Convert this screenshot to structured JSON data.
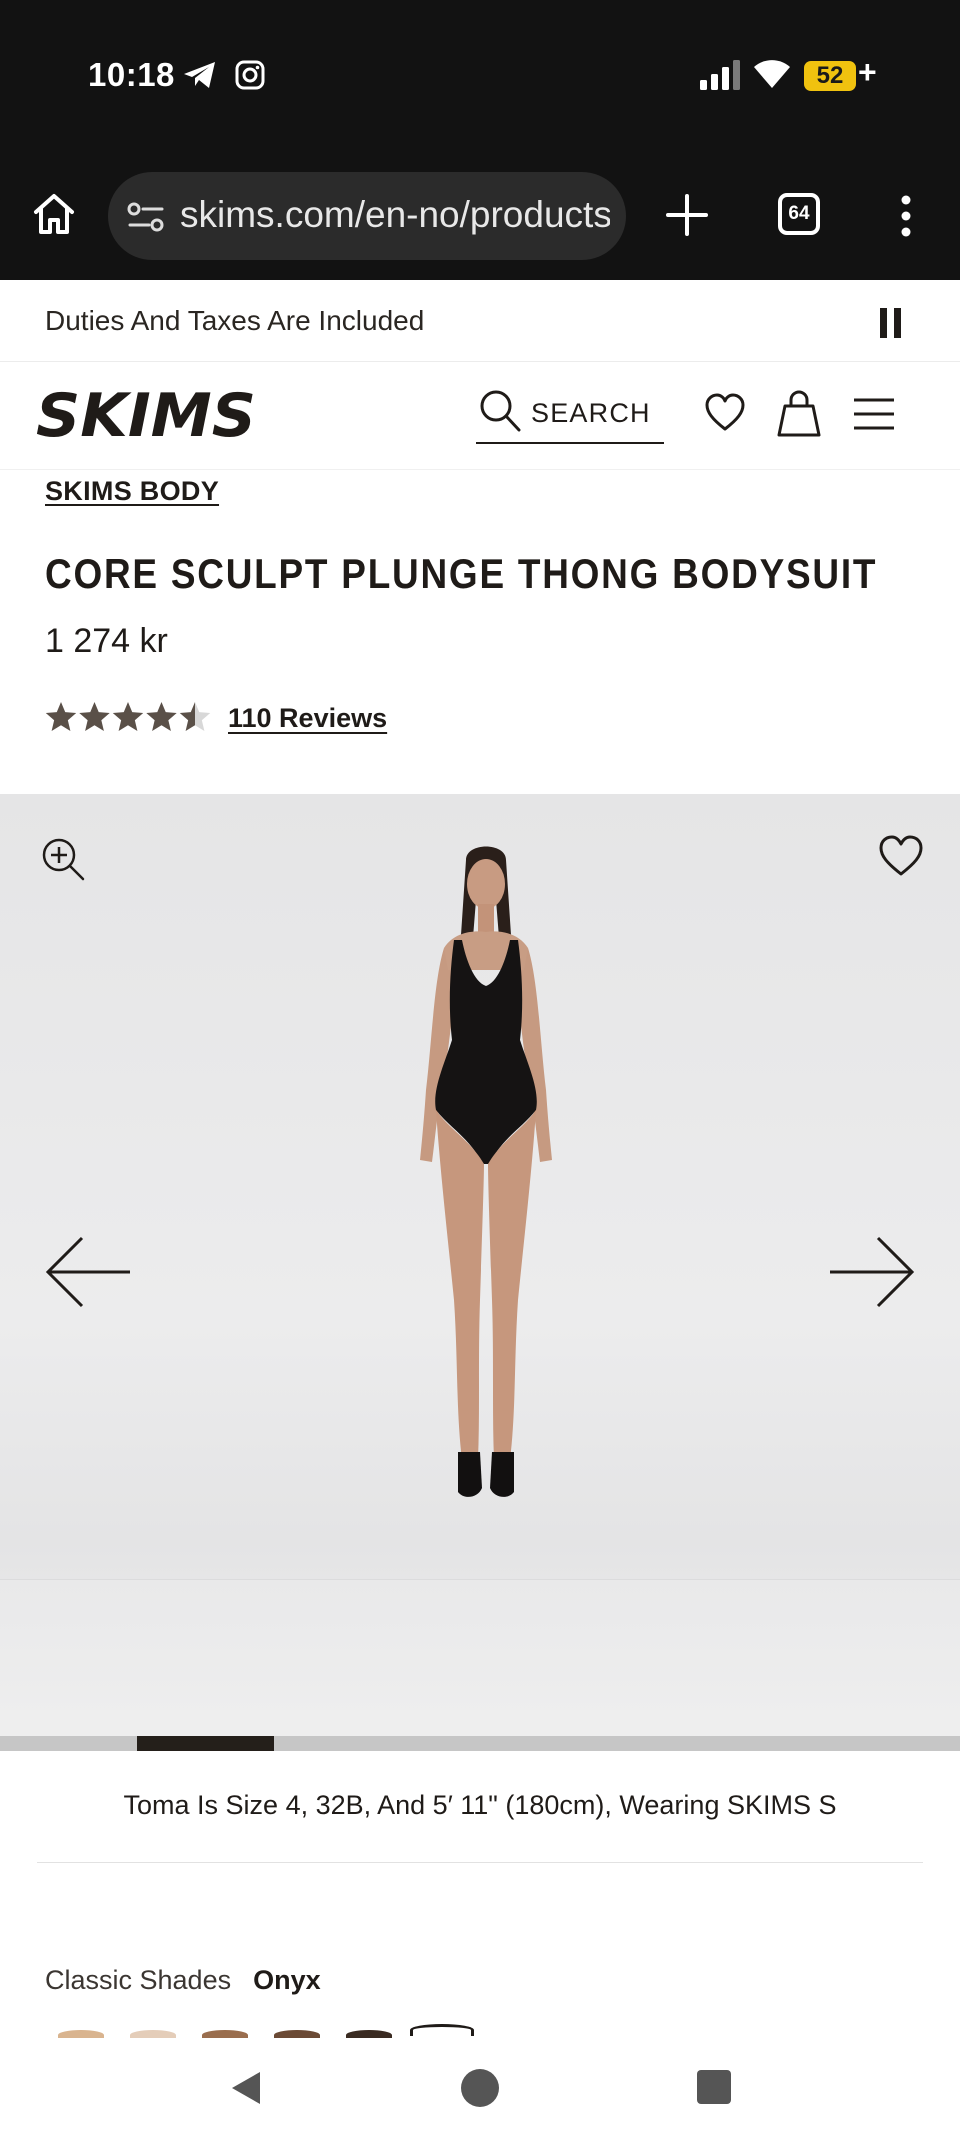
{
  "status_bar": {
    "time": "10:18",
    "battery": "52",
    "battery_suffix": "+",
    "icons": [
      "telegram-icon",
      "instagram-icon",
      "signal-icon",
      "wifi-icon",
      "battery-icon"
    ]
  },
  "browser": {
    "url": "skims.com/en-no/products",
    "tab_count": "64",
    "icons": [
      "home-icon",
      "site-settings-icon",
      "new-tab-icon",
      "tabs-icon",
      "more-vert-icon"
    ]
  },
  "announcement": {
    "text": "Duties And Taxes Are Included"
  },
  "header": {
    "logo": "SKIMS",
    "search_label": "SEARCH",
    "icons": [
      "search-icon",
      "heart-icon",
      "bag-icon",
      "menu-icon"
    ]
  },
  "product": {
    "collection": "SKIMS BODY",
    "title": "CORE SCULPT PLUNGE THONG BODYSUIT",
    "price": "1 274 kr",
    "rating": 4.5,
    "rating_max": 5,
    "reviews_label": "110 Reviews"
  },
  "gallery": {
    "current_slide_index": 1,
    "slide_progress_fraction": 0.143,
    "icons": [
      "zoom-in-icon",
      "heart-icon",
      "arrow-left-icon",
      "arrow-right-icon"
    ]
  },
  "size_caption": "Toma Is Size 4, 32B, And 5′ 11\" (180cm), Wearing SKIMS S",
  "shades": {
    "label": "Classic Shades",
    "selected": "Onyx"
  },
  "colors": {
    "brand_text": "#1f1b18",
    "star": "#5a5048",
    "battery": "#f0c20f"
  }
}
